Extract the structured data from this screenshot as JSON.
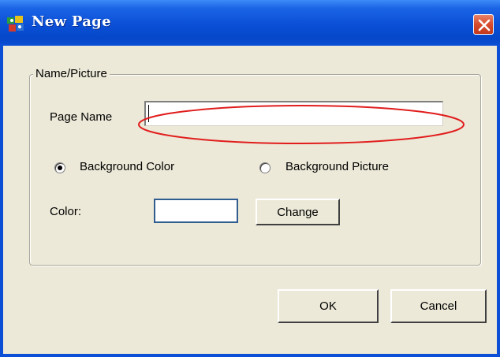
{
  "window": {
    "title": "New Page",
    "icon": "app-icon",
    "close_icon": "close-icon",
    "colors": {
      "titlebar": "#0a4fd6",
      "face": "#ece9d8",
      "close_button": "#d84b2c",
      "highlight_ellipse": "#e11d1d"
    }
  },
  "group": {
    "legend": "Name/Picture"
  },
  "page_name": {
    "label": "Page Name",
    "value": "",
    "placeholder": ""
  },
  "background": {
    "options": [
      {
        "label": "Background Color",
        "selected": true
      },
      {
        "label": "Background Picture",
        "selected": false
      }
    ]
  },
  "color": {
    "label": "Color:",
    "swatch": "#ffffff",
    "change_label": "Change"
  },
  "buttons": {
    "ok_label": "OK",
    "cancel_label": "Cancel"
  }
}
